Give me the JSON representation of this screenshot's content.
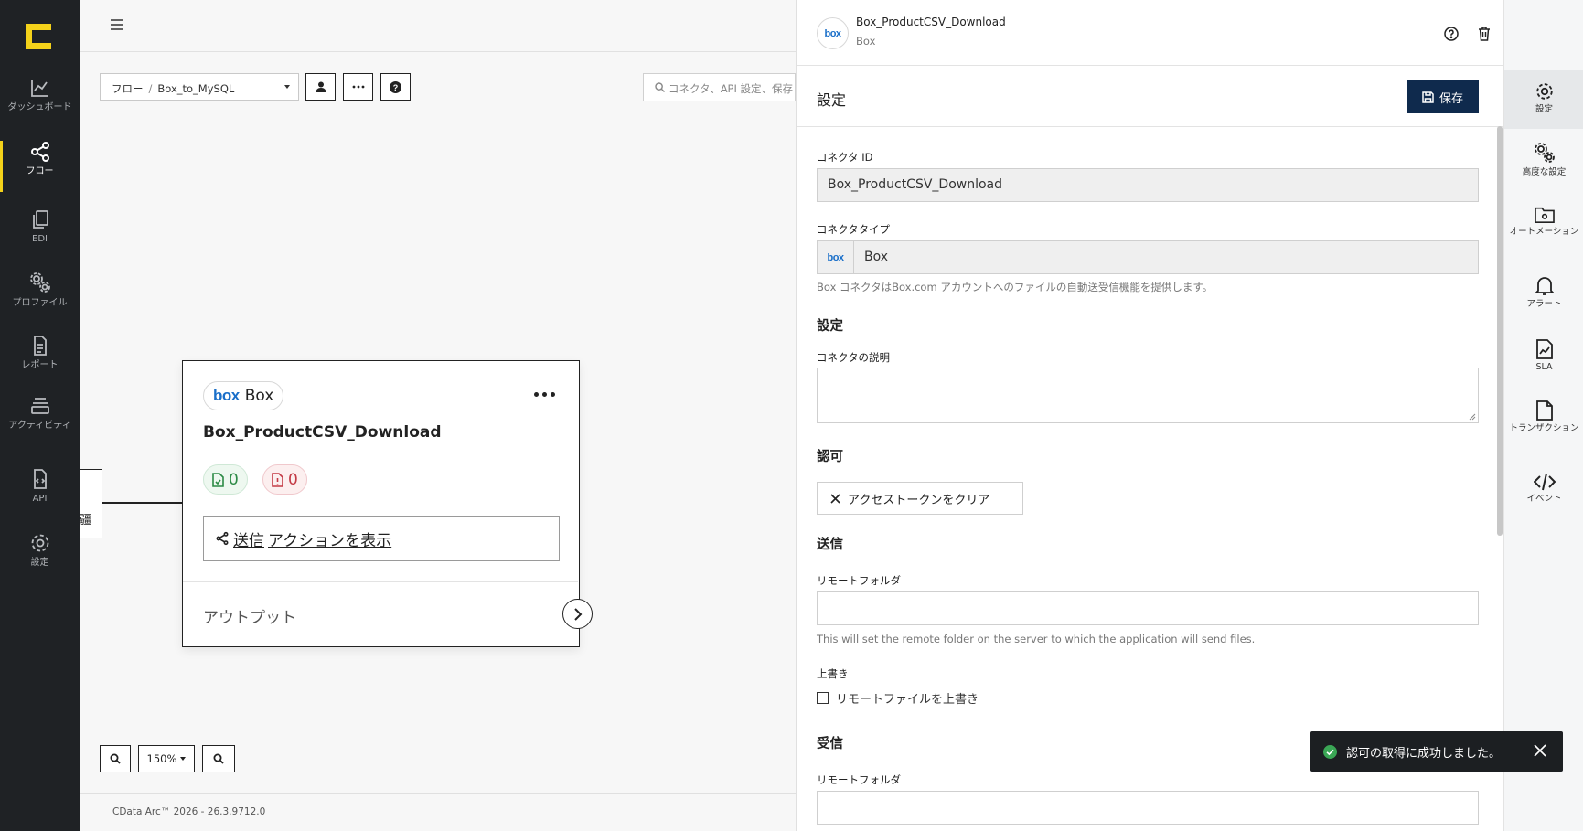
{
  "nav": {
    "items": [
      {
        "label": "ダッシュボード",
        "icon": "chart-line-icon"
      },
      {
        "label": "フロー",
        "icon": "share-icon"
      },
      {
        "label": "EDI",
        "icon": "copy-icon"
      },
      {
        "label": "プロファイル",
        "icon": "gears-icon"
      },
      {
        "label": "レポート",
        "icon": "file-icon"
      },
      {
        "label": "アクティビティ",
        "icon": "layers-icon"
      },
      {
        "label": "API",
        "icon": "file-code-icon"
      },
      {
        "label": "設定",
        "icon": "gear-icon"
      }
    ],
    "active": "フロー"
  },
  "breadcrumb": {
    "root": "フロー",
    "current": "Box_to_MySQL"
  },
  "search": {
    "placeholder": "コネクタ、API 設定、保存"
  },
  "left_stub_text": "疆",
  "node": {
    "chip_logo": "box",
    "chip_label": "Box",
    "title": "Box_ProductCSV_Download",
    "success_count": "0",
    "error_count": "0",
    "send_action_prefix": "送信",
    "send_action_label": " アクションを表示",
    "output_label": "アウトプット"
  },
  "zoom": {
    "level": "150%"
  },
  "footer": {
    "version": "CData Arc™ 2026 - 26.3.9712.0"
  },
  "panel": {
    "avatar_logo": "box",
    "title": "Box_ProductCSV_Download",
    "subtitle": "Box",
    "section_title": "設定",
    "save_label": "保存",
    "fields": {
      "connector_id_label": "コネクタ ID",
      "connector_id_value": "Box_ProductCSV_Download",
      "connector_type_label": "コネクタタイプ",
      "connector_type_logo": "box",
      "connector_type_value": "Box",
      "connector_type_help": "Box コネクタはBox.com アカウントへのファイルの自動送受信機能を提供します。",
      "settings_heading": "設定",
      "description_label": "コネクタの説明",
      "auth_heading": "認可",
      "clear_token_label": "アクセストークンをクリア",
      "send_heading": "送信",
      "remote_folder_label": "リモートフォルダ",
      "remote_folder_help": "This will set the remote folder on the server to which the application will send files.",
      "overwrite_label": "上書き",
      "overwrite_checkbox_label": "リモートファイルを上書き",
      "receive_heading": "受信",
      "receive_remote_folder_label": "リモートフォルダ"
    }
  },
  "rail": {
    "items": [
      {
        "label": "設定",
        "icon": "gear-icon"
      },
      {
        "label": "高度な設定",
        "icon": "gears-icon"
      },
      {
        "label": "オートメーション",
        "icon": "folder-gear-icon"
      },
      {
        "label": "アラート",
        "icon": "bell-icon"
      },
      {
        "label": "SLA",
        "icon": "file-chart-icon"
      },
      {
        "label": "トランザクション",
        "icon": "document-icon"
      },
      {
        "label": "イベント",
        "icon": "code-icon"
      }
    ]
  },
  "toast": {
    "message": "認可の取得に成功しました。"
  },
  "colors": {
    "nav_bg": "#1f2225",
    "accent_yellow": "#f4d21a",
    "save_bg": "#0f2a4d",
    "box_blue": "#1a6fc9",
    "success": "#2c8a45",
    "error": "#c33a45"
  }
}
